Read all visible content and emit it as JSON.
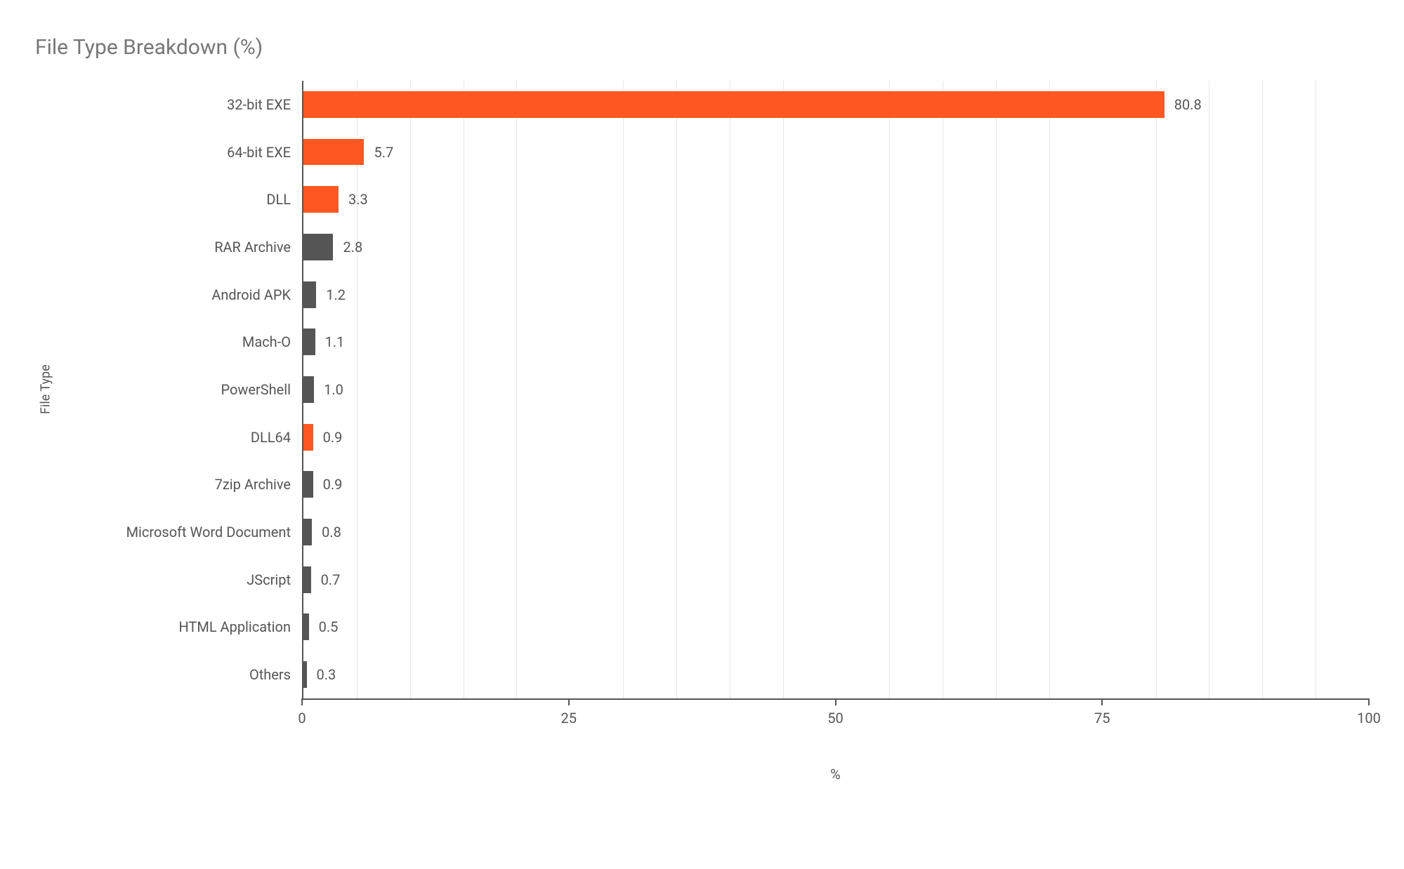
{
  "chart_data": {
    "type": "bar",
    "orientation": "horizontal",
    "title": "File Type Breakdown (%)",
    "xlabel": "%",
    "ylabel": "File Type",
    "xlim": [
      0,
      100
    ],
    "xticks": [
      0,
      25,
      50,
      75,
      100
    ],
    "grid_minor": [
      5,
      10,
      15,
      20,
      30,
      35,
      40,
      45,
      55,
      60,
      65,
      70,
      80,
      85,
      90,
      95
    ],
    "categories": [
      "32-bit EXE",
      "64-bit EXE",
      "DLL",
      "RAR Archive",
      "Android APK",
      "Mach-O",
      "PowerShell",
      "DLL64",
      "7zip Archive",
      "Microsoft Word Document",
      "JScript",
      "HTML Application",
      "Others"
    ],
    "values": [
      80.8,
      5.7,
      3.3,
      2.8,
      1.2,
      1.1,
      1.0,
      0.9,
      0.9,
      0.8,
      0.7,
      0.5,
      0.3
    ],
    "colors": [
      "#ff5722",
      "#ff5722",
      "#ff5722",
      "#555555",
      "#555555",
      "#555555",
      "#555555",
      "#ff5722",
      "#555555",
      "#555555",
      "#555555",
      "#555555",
      "#555555"
    ],
    "value_labels": [
      "80.8",
      "5.7",
      "3.3",
      "2.8",
      "1.2",
      "1.1",
      "1.0",
      "0.9",
      "0.9",
      "0.8",
      "0.7",
      "0.5",
      "0.3"
    ]
  }
}
